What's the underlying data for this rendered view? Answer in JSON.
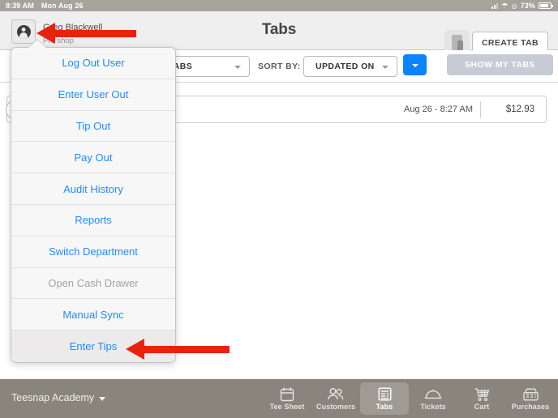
{
  "statusbar": {
    "time": "8:39 AM",
    "date": "Mon Aug 26",
    "battery_percent": "73%",
    "icons": [
      "signal-bars-icon",
      "wifi-icon",
      "location-arrow-icon",
      "battery-icon"
    ]
  },
  "header": {
    "user_name": "Greg Blackwell",
    "user_department": "Pro shop",
    "title": "Tabs",
    "create_tab_label": "CREATE TAB",
    "card_reader_status_color": "#4cd137"
  },
  "filterbar": {
    "tabs_filter_value": "ALL TABS",
    "sort_by_label": "SORT BY:",
    "sort_value": "UPDATED ON",
    "show_my_tabs_label": "SHOW MY TABS",
    "sort_direction_icon": "chevron-down-icon"
  },
  "tab_list": {
    "rows": [
      {
        "time": "Aug 26 - 8:27 AM",
        "amount": "$12.93"
      }
    ]
  },
  "popover": {
    "items": [
      {
        "label": "Log Out User",
        "state": "enabled"
      },
      {
        "label": "Enter User Out",
        "state": "enabled"
      },
      {
        "label": "Tip Out",
        "state": "enabled"
      },
      {
        "label": "Pay Out",
        "state": "enabled"
      },
      {
        "label": "Audit History",
        "state": "enabled"
      },
      {
        "label": "Reports",
        "state": "enabled"
      },
      {
        "label": "Switch Department",
        "state": "enabled"
      },
      {
        "label": "Open Cash Drawer",
        "state": "disabled"
      },
      {
        "label": "Manual Sync",
        "state": "enabled"
      },
      {
        "label": "Enter Tips",
        "state": "highlighted"
      }
    ],
    "link_color": "#1e8bff",
    "disabled_color": "#a3a3a3"
  },
  "annotations": {
    "arrow_color": "#e8230d",
    "arrows": [
      {
        "points_to": "user-menu-button"
      },
      {
        "points_to": "menu-item-enter-tips"
      }
    ]
  },
  "bottombar": {
    "brand": "Teesnap Academy",
    "nav": [
      {
        "label": "Tee Sheet",
        "icon": "calendar-icon",
        "active": false
      },
      {
        "label": "Customers",
        "icon": "people-icon",
        "active": false
      },
      {
        "label": "Tabs",
        "icon": "list-document-icon",
        "active": true
      },
      {
        "label": "Tickets",
        "icon": "cloche-icon",
        "active": false
      },
      {
        "label": "Cart",
        "icon": "shopping-cart-icon",
        "active": false
      },
      {
        "label": "Purchases",
        "icon": "cash-register-icon",
        "active": false
      }
    ]
  }
}
